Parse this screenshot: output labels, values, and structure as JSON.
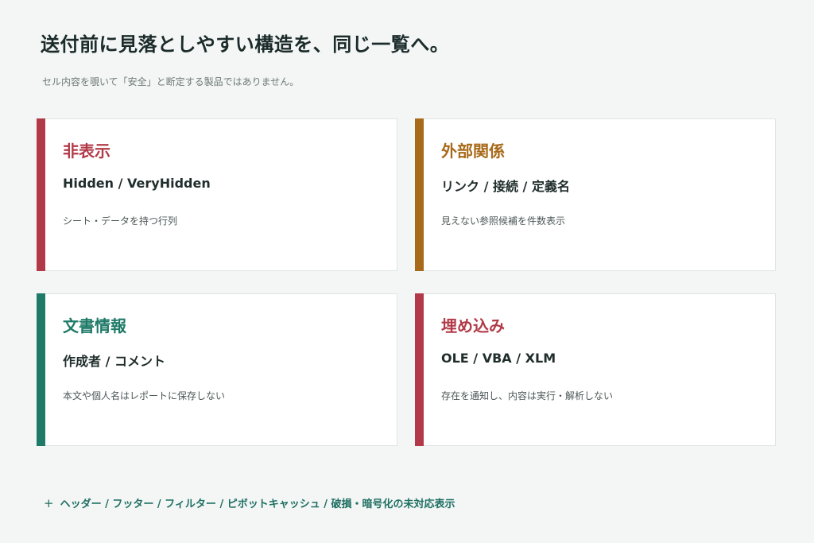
{
  "title": "送付前に見落としやすい構造を、同じ一覧へ。",
  "subtitle": "セル内容を覗いて「安全」と断定する製品ではありません。",
  "cards": [
    {
      "name": "非表示",
      "sub": "Hidden / VeryHidden",
      "desc": "シート・データを持つ行列",
      "accent": "#b23a48"
    },
    {
      "name": "外部関係",
      "sub": "リンク / 接続 / 定義名",
      "desc": "見えない参照候補を件数表示",
      "accent": "#a86a1a"
    },
    {
      "name": "文書情報",
      "sub": "作成者 / コメント",
      "desc": "本文や個人名はレポートに保存しない",
      "accent": "#1f7a68"
    },
    {
      "name": "埋め込み",
      "sub": "OLE / VBA / XLM",
      "desc": "存在を通知し、内容は実行・解析しない",
      "accent": "#b23a48"
    }
  ],
  "footnote": {
    "icon": "plus-icon",
    "text": "ヘッダー / フッター / フィルター / ピボットキャッシュ / 破損・暗号化の未対応表示"
  }
}
